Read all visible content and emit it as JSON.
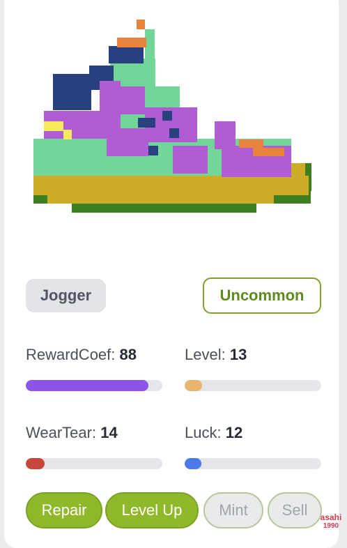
{
  "item": {
    "type_label": "Jogger",
    "rarity_label": "Uncommon",
    "image": "pixel-art-sneaker"
  },
  "stats": [
    {
      "label": "RewardCoef:",
      "value": "88",
      "fill": 0.9,
      "color": "#8b55ea"
    },
    {
      "label": "Level:",
      "value": "13",
      "fill": 0.13,
      "color": "#e8b46e"
    },
    {
      "label": "WearTear:",
      "value": "14",
      "fill": 0.14,
      "color": "#c9463b"
    },
    {
      "label": "Luck:",
      "value": "12",
      "fill": 0.12,
      "color": "#4b7ae8"
    }
  ],
  "actions": {
    "repair": "Repair",
    "level_up": "Level Up",
    "mint": "Mint",
    "sell": "Sell"
  },
  "watermark": {
    "line1": "asahi",
    "line2": "1990"
  },
  "colors": {
    "primary_green": "#8fb82a",
    "rarity_green": "#5f8a1e"
  }
}
